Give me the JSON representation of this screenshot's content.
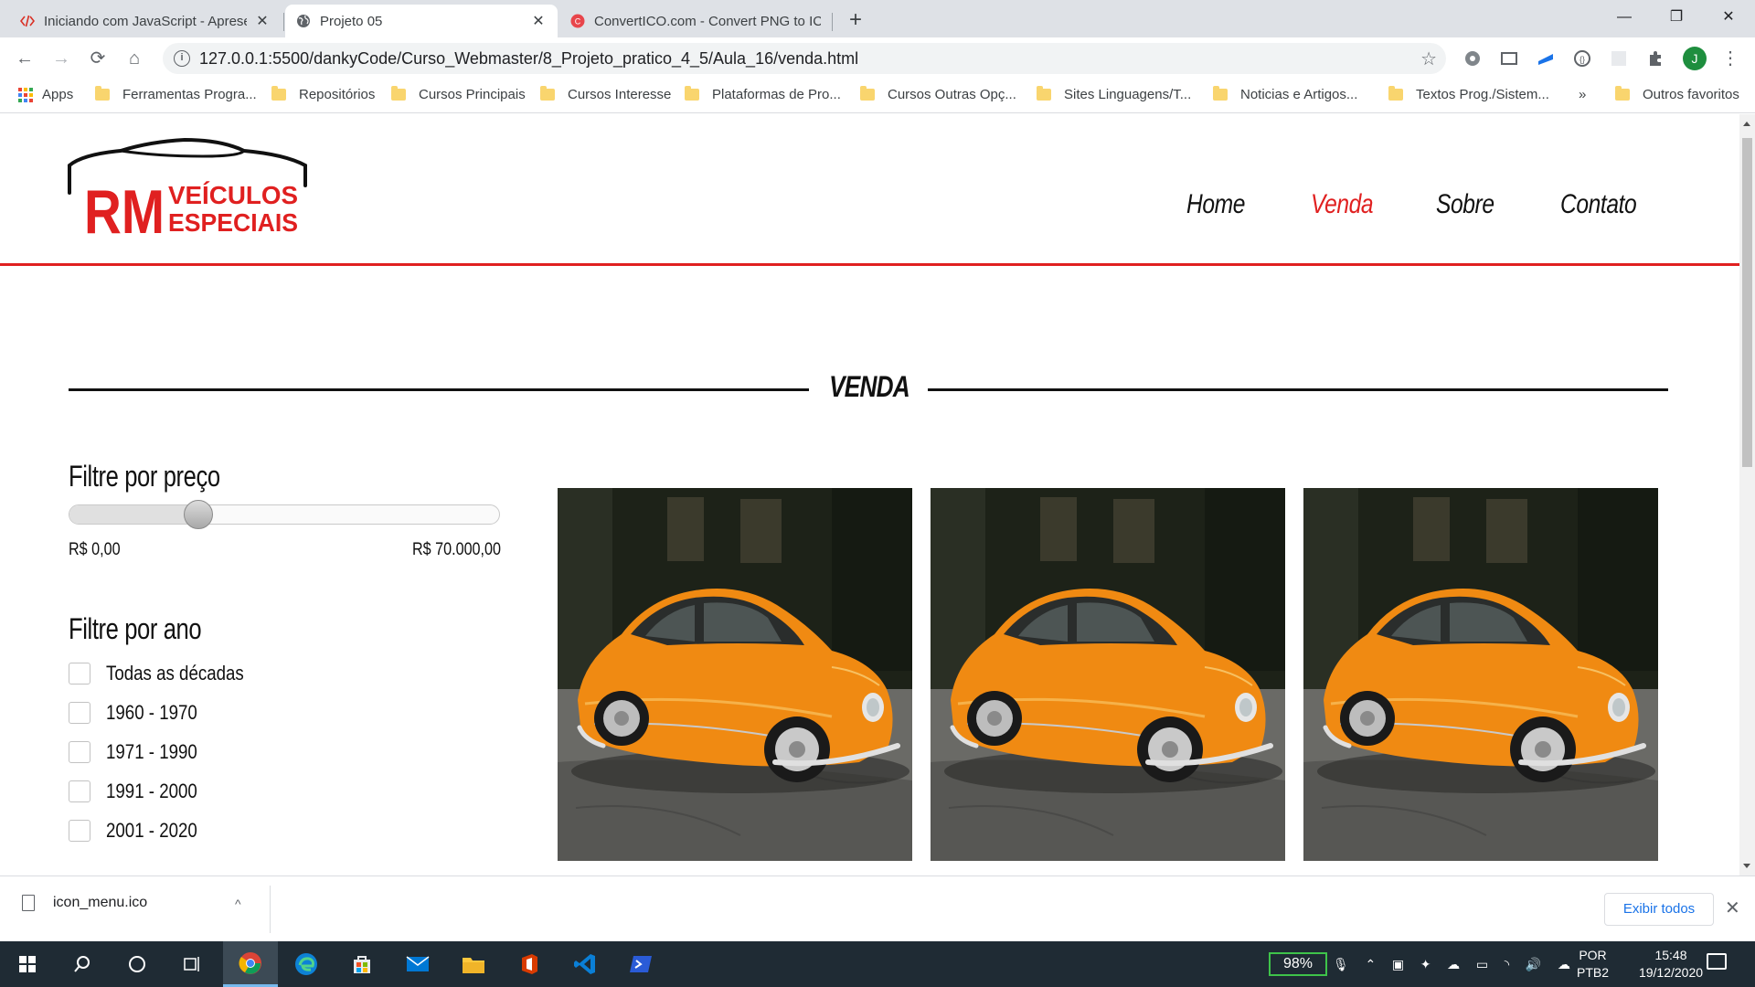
{
  "browser": {
    "tabs": [
      {
        "title": "Iniciando com JavaScript - Apresentação",
        "active": false
      },
      {
        "title": "Projeto 05",
        "active": true
      },
      {
        "title": "ConvertICO.com - Convert PNG to ICO",
        "active": false
      }
    ],
    "new_tab": "+",
    "window_controls": {
      "minimize": "—",
      "maximize": "❐",
      "close": "✕"
    },
    "nav": {
      "back": "←",
      "forward": "→",
      "reload": "⟳",
      "home": "⌂"
    },
    "url": "127.0.0.1:5500/dankyCode/Curso_Webmaster/8_Projeto_pratico_4_5/Aula_16/venda.html",
    "info_icon": "i",
    "star": "☆",
    "profile_initial": "J",
    "menu": "⋮",
    "bookmarks": [
      "Apps",
      "Ferramentas Progra...",
      "Repositórios",
      "Cursos Principais",
      "Cursos Interesse",
      "Plataformas de Pro...",
      "Cursos Outras Opç...",
      "Sites Linguagens/T...",
      "Noticias e Artigos...",
      "Textos Prog./Sistem..."
    ],
    "bookmarks_overflow": "»",
    "other_bookmarks": "Outros favoritos"
  },
  "site": {
    "logo": {
      "big": "RM",
      "line1": "VEÍCULOS",
      "line2": "ESPECIAIS"
    },
    "nav": [
      {
        "label": "Home",
        "active": false
      },
      {
        "label": "Venda",
        "active": true
      },
      {
        "label": "Sobre",
        "active": false
      },
      {
        "label": "Contato",
        "active": false
      }
    ],
    "section_title": "VENDA",
    "price_filter": {
      "title": "Filtre por preço",
      "min_label": "R$ 0,00",
      "max_label": "R$ 70.000,00",
      "value_fraction": 0.3
    },
    "year_filter": {
      "title": "Filtre por ano",
      "options": [
        "Todas as décadas",
        "1960 - 1970",
        "1971 - 1990",
        "1991 - 2000",
        "2001 - 2020"
      ]
    },
    "cars_count_visible": 3
  },
  "downloads": {
    "file": "icon_menu.ico",
    "chevron": "^",
    "show_all": "Exibir todos",
    "close": "✕"
  },
  "taskbar": {
    "battery": "98%",
    "lang_line1": "POR",
    "lang_line2": "PTB2",
    "time": "15:48",
    "date": "19/12/2020"
  },
  "colors": {
    "accent_red": "#e02020",
    "car_orange": "#f08a12"
  }
}
